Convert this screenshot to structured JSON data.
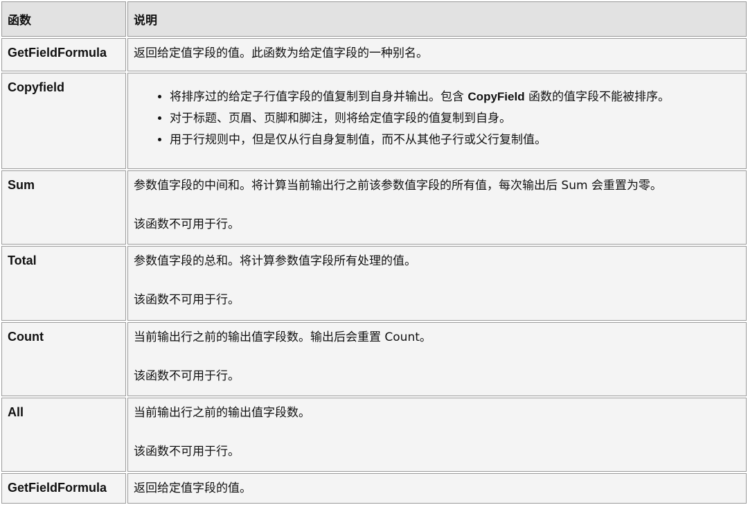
{
  "header": {
    "col_function": "函数",
    "col_description": "说明"
  },
  "rows": [
    {
      "name": "GetFieldFormula",
      "paragraphs": [
        "返回给定值字段的值。此函数为给定值字段的一种别名。"
      ]
    },
    {
      "name": "Copyfield",
      "bullets": [
        {
          "before": "将排序过的给定子行值字段的值复制到自身并输出。包含 ",
          "strong": "CopyField",
          "after": " 函数的值字段不能被排序。"
        },
        {
          "text": "对于标题、页眉、页脚和脚注，则将给定值字段的值复制到自身。"
        },
        {
          "text": "用于行规则中，但是仅从行自身复制值，而不从其他子行或父行复制值。"
        }
      ]
    },
    {
      "name": "Sum",
      "paragraphs": [
        "参数值字段的中间和。将计算当前输出行之前该参数值字段的所有值，每次输出后 Sum 会重置为零。",
        "该函数不可用于行。"
      ]
    },
    {
      "name": "Total",
      "paragraphs": [
        "参数值字段的总和。将计算参数值字段所有处理的值。",
        "该函数不可用于行。"
      ]
    },
    {
      "name": "Count",
      "paragraphs": [
        "当前输出行之前的输出值字段数。输出后会重置 Count。",
        "该函数不可用于行。"
      ]
    },
    {
      "name": "All",
      "paragraphs": [
        "当前输出行之前的输出值字段数。",
        "该函数不可用于行。"
      ]
    },
    {
      "name": "GetFieldFormula",
      "paragraphs": [
        "返回给定值字段的值。"
      ]
    }
  ]
}
